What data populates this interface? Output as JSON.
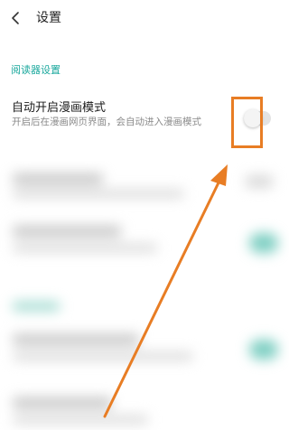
{
  "header": {
    "title": "设置",
    "back_icon": "chevron-left-icon"
  },
  "section": {
    "title": "阅读器设置"
  },
  "setting": {
    "title": "自动开启漫画模式",
    "description": "开启后在漫画网页界面，会自动进入漫画模式",
    "enabled": false
  },
  "colors": {
    "accent": "#1ca99e",
    "highlight": "#e87d24",
    "arrow": "#e87d24"
  }
}
